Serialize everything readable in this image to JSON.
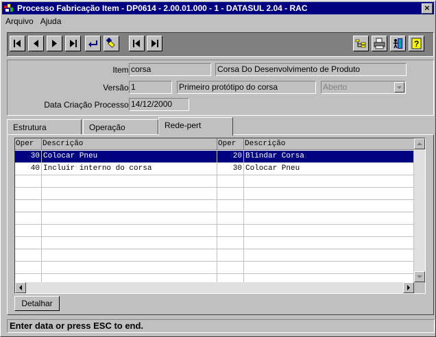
{
  "window": {
    "title": "Processo Fabricação Item - DP0614 - 2.00.01.000 - 1 - DATASUL 2.04 - RAC",
    "close_glyph": "×"
  },
  "menu": [
    "Arquivo",
    "Ajuda"
  ],
  "toolbar": {
    "buttons": [
      "first-icon",
      "prev-icon",
      "next-icon",
      "last-icon",
      "goto-icon",
      "search-icon",
      "first-page-icon",
      "last-page-icon",
      "tree-icon",
      "print-icon",
      "exit-icon",
      "help-icon"
    ]
  },
  "form": {
    "item_label": "Item:",
    "item_code": "corsa",
    "item_desc": "Corsa Do Desenvolvimento de Produto",
    "versao_label": "Versão:",
    "versao_num": "1",
    "versao_desc": "Primeiro protótipo do corsa",
    "versao_status": "Aberto",
    "data_label": "Data Criação Processo:",
    "data_value": "14/12/2000"
  },
  "tabs": [
    "Estrutura",
    "Operação",
    "Rede-pert"
  ],
  "active_tab": "Rede-pert",
  "grid": {
    "headers": [
      "Oper",
      "Descrição",
      "Oper",
      "Descrição"
    ],
    "rows": [
      {
        "oper1": "30",
        "desc1": "Colocar Pneu",
        "oper2": "20",
        "desc2": "Blindar Corsa",
        "selected": true
      },
      {
        "oper1": "40",
        "desc1": "Incluir interno do corsa",
        "oper2": "30",
        "desc2": "Colocar Pneu",
        "selected": false
      }
    ]
  },
  "detalhar_label": "Detalhar",
  "status_text": "Enter data or press ESC to end.",
  "colors": {
    "title_bg": "#000080",
    "selection_bg": "#000080",
    "face": "#c0c0c0"
  }
}
